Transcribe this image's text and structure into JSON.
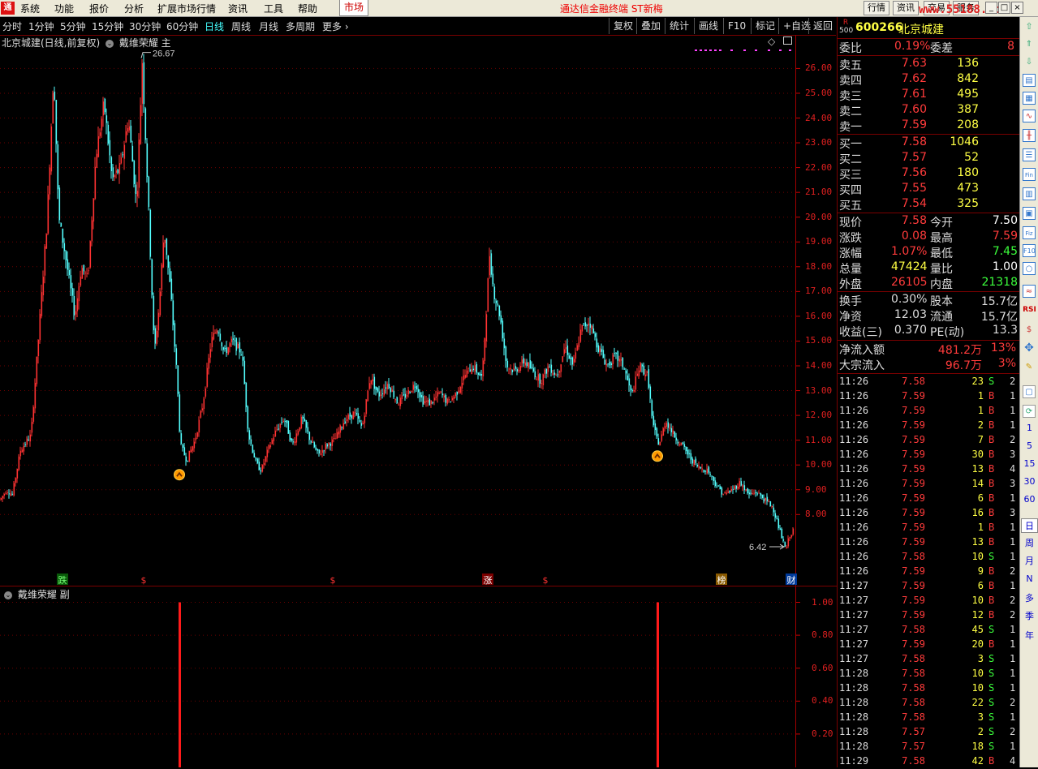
{
  "menu": {
    "items": [
      "系统",
      "功能",
      "报价",
      "分析",
      "扩展市场行情",
      "资讯",
      "工具",
      "帮助"
    ],
    "active": "市场",
    "promo": "通达信金融终端  ST新梅",
    "right_buttons": [
      "行情",
      "资讯",
      "交易",
      "服务"
    ],
    "watermark": "www.55188.com"
  },
  "periods": {
    "items": [
      "分时",
      "1分钟",
      "5分钟",
      "15分钟",
      "30分钟",
      "60分钟",
      "日线",
      "周线",
      "月线",
      "多周期",
      "更多"
    ],
    "active": "日线",
    "tools": [
      "复权",
      "叠加",
      "统计",
      "画线",
      "F10",
      "标记",
      "+自选",
      "返回"
    ]
  },
  "chart": {
    "title": "北京城建(日线,前复权)",
    "indicator": "戴维荣耀 主",
    "sub_indicator": "戴维荣耀 副",
    "high_label": "26.67",
    "low_label": "6.42",
    "y_ticks": [
      "26.00",
      "25.00",
      "24.00",
      "23.00",
      "22.00",
      "21.00",
      "20.00",
      "19.00",
      "18.00",
      "17.00",
      "16.00",
      "15.00",
      "14.00",
      "13.00",
      "12.00",
      "11.00",
      "10.00",
      "9.00",
      "8.00"
    ],
    "sub_y_ticks": [
      "1.00",
      "0.80",
      "0.60",
      "0.40",
      "0.20"
    ],
    "markers": [
      "跌",
      "$",
      "$",
      "涨",
      "$",
      "榜",
      "财"
    ]
  },
  "quote": {
    "code": "600266",
    "name": "北京城建",
    "r_badge": "R",
    "r_num": "500",
    "weibi_label": "委比",
    "weibi": "0.19%",
    "weicha_label": "委差",
    "weicha": "8",
    "sell": [
      {
        "label": "卖五",
        "price": "7.63",
        "vol": "136"
      },
      {
        "label": "卖四",
        "price": "7.62",
        "vol": "842"
      },
      {
        "label": "卖三",
        "price": "7.61",
        "vol": "495"
      },
      {
        "label": "卖二",
        "price": "7.60",
        "vol": "387"
      },
      {
        "label": "卖一",
        "price": "7.59",
        "vol": "208"
      }
    ],
    "buy": [
      {
        "label": "买一",
        "price": "7.58",
        "vol": "1046"
      },
      {
        "label": "买二",
        "price": "7.57",
        "vol": "52"
      },
      {
        "label": "买三",
        "price": "7.56",
        "vol": "180"
      },
      {
        "label": "买四",
        "price": "7.55",
        "vol": "473"
      },
      {
        "label": "买五",
        "price": "7.54",
        "vol": "325"
      }
    ],
    "stats": [
      {
        "l1": "现价",
        "v1": "7.58",
        "l2": "今开",
        "v2": "7.50",
        "c1": "#ff3b3b",
        "c2": "#ffffff"
      },
      {
        "l1": "涨跌",
        "v1": "0.08",
        "l2": "最高",
        "v2": "7.59",
        "c1": "#ff3b3b",
        "c2": "#ff3b3b"
      },
      {
        "l1": "涨幅",
        "v1": "1.07%",
        "l2": "最低",
        "v2": "7.45",
        "c1": "#ff3b3b",
        "c2": "#3cff3c"
      },
      {
        "l1": "总量",
        "v1": "47424",
        "l2": "量比",
        "v2": "1.00",
        "c1": "#ffff44",
        "c2": "#ffffff"
      },
      {
        "l1": "外盘",
        "v1": "26105",
        "l2": "内盘",
        "v2": "21318",
        "c1": "#ff3b3b",
        "c2": "#3cff3c"
      }
    ],
    "stats2": [
      {
        "l1": "换手",
        "v1": "0.30%",
        "l2": "股本",
        "v2": "15.7亿"
      },
      {
        "l1": "净资",
        "v1": "12.03",
        "l2": "流通",
        "v2": "15.7亿"
      },
      {
        "l1": "收益(三)",
        "v1": "0.370",
        "l2": "PE(动)",
        "v2": "13.3"
      }
    ],
    "flows": [
      {
        "label": "净流入额",
        "value": "481.2万",
        "pct": "13%"
      },
      {
        "label": "大宗流入",
        "value": "96.7万",
        "pct": "3%"
      }
    ],
    "ticks": [
      [
        "11:26",
        "7.58",
        "23",
        "S",
        "2"
      ],
      [
        "11:26",
        "7.59",
        "1",
        "B",
        "1"
      ],
      [
        "11:26",
        "7.59",
        "1",
        "B",
        "1"
      ],
      [
        "11:26",
        "7.59",
        "2",
        "B",
        "1"
      ],
      [
        "11:26",
        "7.59",
        "7",
        "B",
        "2"
      ],
      [
        "11:26",
        "7.59",
        "30",
        "B",
        "3"
      ],
      [
        "11:26",
        "7.59",
        "13",
        "B",
        "4"
      ],
      [
        "11:26",
        "7.59",
        "14",
        "B",
        "3"
      ],
      [
        "11:26",
        "7.59",
        "6",
        "B",
        "1"
      ],
      [
        "11:26",
        "7.59",
        "16",
        "B",
        "3"
      ],
      [
        "11:26",
        "7.59",
        "1",
        "B",
        "1"
      ],
      [
        "11:26",
        "7.59",
        "13",
        "B",
        "1"
      ],
      [
        "11:26",
        "7.58",
        "10",
        "S",
        "1"
      ],
      [
        "11:26",
        "7.59",
        "9",
        "B",
        "2"
      ],
      [
        "11:27",
        "7.59",
        "6",
        "B",
        "1"
      ],
      [
        "11:27",
        "7.59",
        "10",
        "B",
        "2"
      ],
      [
        "11:27",
        "7.59",
        "12",
        "B",
        "2"
      ],
      [
        "11:27",
        "7.58",
        "45",
        "S",
        "1"
      ],
      [
        "11:27",
        "7.59",
        "20",
        "B",
        "1"
      ],
      [
        "11:27",
        "7.58",
        "3",
        "S",
        "1"
      ],
      [
        "11:28",
        "7.58",
        "10",
        "S",
        "1"
      ],
      [
        "11:28",
        "7.58",
        "10",
        "S",
        "1"
      ],
      [
        "11:28",
        "7.58",
        "22",
        "S",
        "2"
      ],
      [
        "11:28",
        "7.58",
        "3",
        "S",
        "1"
      ],
      [
        "11:28",
        "7.57",
        "2",
        "S",
        "2"
      ],
      [
        "11:28",
        "7.57",
        "18",
        "S",
        "1"
      ],
      [
        "11:29",
        "7.58",
        "42",
        "B",
        "4"
      ]
    ]
  },
  "sidebar": {
    "periods": [
      "1",
      "5",
      "15",
      "30",
      "60",
      "日",
      "周",
      "月",
      "N",
      "多",
      "季",
      "年"
    ],
    "rsi": "RSI"
  }
}
